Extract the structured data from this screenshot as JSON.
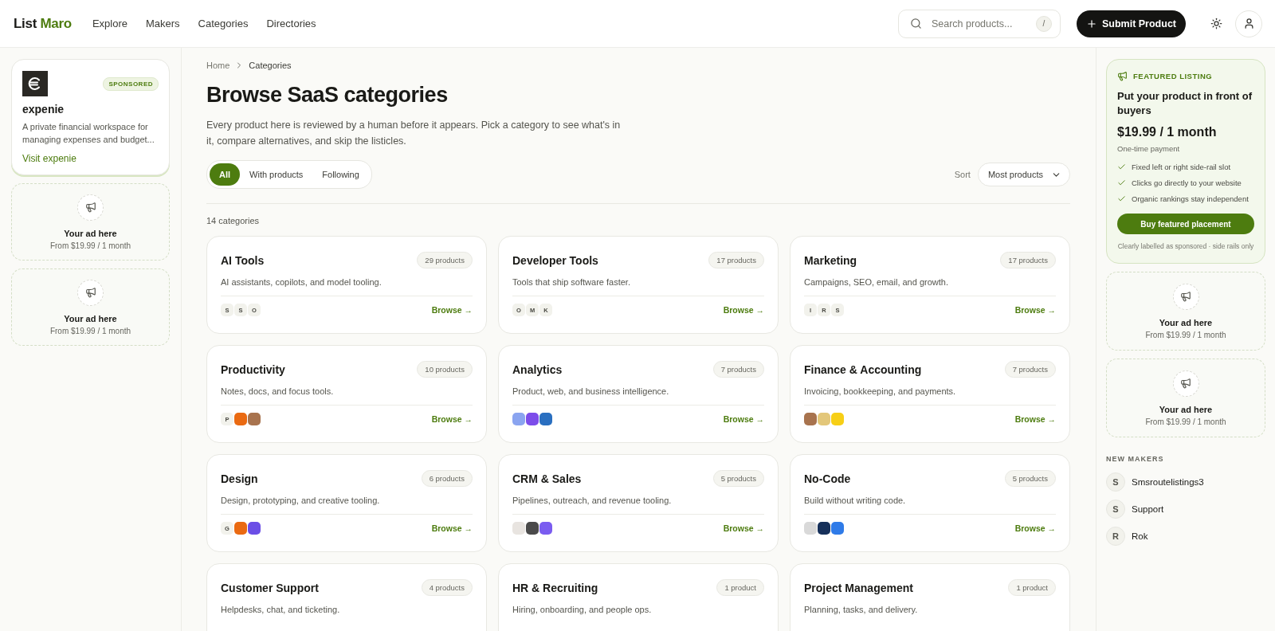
{
  "header": {
    "brand": {
      "first": "List",
      "second": "Maro"
    },
    "nav": [
      {
        "label": "Explore",
        "selected": false
      },
      {
        "label": "Makers",
        "selected": false
      },
      {
        "label": "Categories",
        "selected": false
      },
      {
        "label": "Directories",
        "selected": false
      }
    ],
    "search": {
      "placeholder": "Search products...",
      "shortcut": "/"
    },
    "submit_button": "Submit Product"
  },
  "left_rail": {
    "sponsor": {
      "badge": "SPONSORED",
      "name": "expenie",
      "description": "A private financial workspace for managing expenses and budget...",
      "link": "Visit expenie"
    },
    "ad_slots": [
      {
        "title": "Your ad here",
        "price": "From $19.99 / 1 month"
      },
      {
        "title": "Your ad here",
        "price": "From $19.99 / 1 month"
      }
    ]
  },
  "main": {
    "breadcrumb": [
      "Home",
      "Categories"
    ],
    "title": "Browse SaaS categories",
    "intro": "Every product here is reviewed by a human before it appears. Pick a category to see what's in it, compare alternatives, and skip the listicles.",
    "filters": [
      {
        "label": "All",
        "selected": true
      },
      {
        "label": "With products",
        "selected": false
      },
      {
        "label": "Following",
        "selected": false
      }
    ],
    "sort": {
      "label": "Sort",
      "value": "Most products"
    },
    "count": "14 categories",
    "categories": [
      {
        "name": "AI Tools",
        "count": "29 products",
        "description": "AI assistants, copilots, and model tooling.",
        "browse": "Browse →",
        "logos": [
          {
            "kind": "letter",
            "text": "S"
          },
          {
            "kind": "letter",
            "text": "S"
          },
          {
            "kind": "letter",
            "text": "O"
          }
        ]
      },
      {
        "name": "Developer Tools",
        "count": "17 products",
        "description": "Tools that ship software faster.",
        "browse": "Browse →",
        "logos": [
          {
            "kind": "letter",
            "text": "O"
          },
          {
            "kind": "letter",
            "text": "M"
          },
          {
            "kind": "letter",
            "text": "K"
          }
        ]
      },
      {
        "name": "Marketing",
        "count": "17 products",
        "description": "Campaigns, SEO, email, and growth.",
        "browse": "Browse →",
        "logos": [
          {
            "kind": "letter",
            "text": "I"
          },
          {
            "kind": "letter",
            "text": "R"
          },
          {
            "kind": "letter",
            "text": "S"
          }
        ]
      },
      {
        "name": "Productivity",
        "count": "10 products",
        "description": "Notes, docs, and focus tools.",
        "browse": "Browse →",
        "logos": [
          {
            "kind": "letter",
            "text": "P"
          },
          {
            "kind": "logo",
            "color": "#ea6a12"
          },
          {
            "kind": "logo",
            "color": "#a8734e"
          }
        ]
      },
      {
        "name": "Analytics",
        "count": "7 products",
        "description": "Product, web, and business intelligence.",
        "browse": "Browse →",
        "logos": [
          {
            "kind": "logo",
            "color": "#8aa4f0"
          },
          {
            "kind": "logo",
            "color": "#7c4dea"
          },
          {
            "kind": "logo",
            "color": "#2a6fc0"
          }
        ]
      },
      {
        "name": "Finance & Accounting",
        "count": "7 products",
        "description": "Invoicing, bookkeeping, and payments.",
        "browse": "Browse →",
        "logos": [
          {
            "kind": "logo",
            "color": "#a8734e"
          },
          {
            "kind": "logo",
            "color": "#e3c77a"
          },
          {
            "kind": "logo",
            "color": "#f7cf16"
          }
        ]
      },
      {
        "name": "Design",
        "count": "6 products",
        "description": "Design, prototyping, and creative tooling.",
        "browse": "Browse →",
        "logos": [
          {
            "kind": "letter",
            "text": "G"
          },
          {
            "kind": "logo",
            "color": "#ea6a12"
          },
          {
            "kind": "logo",
            "color": "#6b4ee6"
          }
        ]
      },
      {
        "name": "CRM & Sales",
        "count": "5 products",
        "description": "Pipelines, outreach, and revenue tooling.",
        "browse": "Browse →",
        "logos": [
          {
            "kind": "logo",
            "color": "#e8e4e0"
          },
          {
            "kind": "logo",
            "color": "#4a4a4a"
          },
          {
            "kind": "logo",
            "color": "#7a5cf0"
          }
        ]
      },
      {
        "name": "No-Code",
        "count": "5 products",
        "description": "Build without writing code.",
        "browse": "Browse →",
        "logos": [
          {
            "kind": "logo",
            "color": "#d9d9d9"
          },
          {
            "kind": "logo",
            "color": "#16305a"
          },
          {
            "kind": "logo",
            "color": "#2f7be8"
          }
        ]
      },
      {
        "name": "Customer Support",
        "count": "4 products",
        "description": "Helpdesks, chat, and ticketing."
      },
      {
        "name": "HR & Recruiting",
        "count": "1 product",
        "description": "Hiring, onboarding, and people ops."
      },
      {
        "name": "Project Management",
        "count": "1 product",
        "description": "Planning, tasks, and delivery."
      }
    ]
  },
  "right_rail": {
    "featured": {
      "eyebrow": "FEATURED LISTING",
      "title": "Put your product in front of buyers",
      "price": "$19.99 / 1 month",
      "note": "One-time payment",
      "features": [
        "Fixed left or right side-rail slot",
        "Clicks go directly to your website",
        "Organic rankings stay independent"
      ],
      "button": "Buy featured placement",
      "footnote": "Clearly labelled as sponsored · side rails only"
    },
    "ad_slots": [
      {
        "title": "Your ad here",
        "price": "From $19.99 / 1 month"
      },
      {
        "title": "Your ad here",
        "price": "From $19.99 / 1 month"
      }
    ],
    "makers_heading": "NEW MAKERS",
    "makers": [
      {
        "initial": "S",
        "name": "Smsroutelistings3"
      },
      {
        "initial": "S",
        "name": "Support"
      },
      {
        "initial": "R",
        "name": "Rok"
      }
    ]
  }
}
